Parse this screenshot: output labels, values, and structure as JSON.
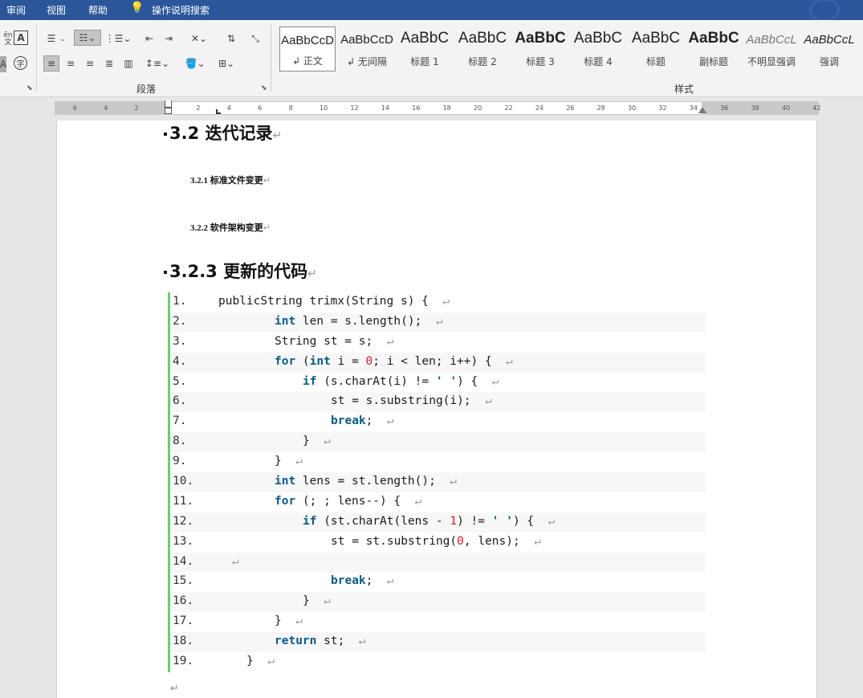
{
  "menubar": {
    "items": [
      "审阅",
      "视图",
      "帮助",
      "操作说明搜索"
    ]
  },
  "ribbon": {
    "groups": {
      "paragraph": "段落",
      "styles": "样式"
    },
    "styles": [
      {
        "preview": "AaBbCcD",
        "name": "↲ 正文",
        "selected": true
      },
      {
        "preview": "AaBbCcD",
        "name": "↲ 无间隔"
      },
      {
        "preview": "AaBbC",
        "name": "标题 1"
      },
      {
        "preview": "AaBbC",
        "name": "标题 2"
      },
      {
        "preview": "AaBbC",
        "name": "标题 3"
      },
      {
        "preview": "AaBbC",
        "name": "标题 4"
      },
      {
        "preview": "AaBbC",
        "name": "标题"
      },
      {
        "preview": "AaBbC",
        "name": "副标题"
      },
      {
        "preview": "AaBbCcL",
        "name": "不明显强调"
      },
      {
        "preview": "AaBbCcL",
        "name": "强调"
      }
    ],
    "left_labels": {
      "wen": "ēn",
      "wen2": "文",
      "A": "A",
      "zi": "字"
    }
  },
  "ruler": {
    "numbers": [
      "6",
      "4",
      "2",
      "2",
      "4",
      "6",
      "8",
      "10",
      "12",
      "14",
      "16",
      "18",
      "20",
      "22",
      "24",
      "26",
      "28",
      "30",
      "32",
      "34",
      "36",
      "38",
      "40",
      "42"
    ]
  },
  "document": {
    "h2": "3.2  迭代记录",
    "h3_1": "3.2.1  标准文件变更",
    "h3_2": "3.2.2  软件架构变更",
    "h3_3": "3.2.3  更新的代码",
    "return_mark": "↵",
    "code_lines": [
      {
        "n": "1."
      },
      {
        "n": "2."
      },
      {
        "n": "3."
      },
      {
        "n": "4."
      },
      {
        "n": "5."
      },
      {
        "n": "6."
      },
      {
        "n": "7."
      },
      {
        "n": "8."
      },
      {
        "n": "9."
      },
      {
        "n": "10."
      },
      {
        "n": "11."
      },
      {
        "n": "12."
      },
      {
        "n": "13."
      },
      {
        "n": "14."
      },
      {
        "n": "15."
      },
      {
        "n": "16."
      },
      {
        "n": "17."
      },
      {
        "n": "18."
      },
      {
        "n": "19."
      }
    ],
    "code": {
      "l1": "publicString trimx(String s) {",
      "l2a": "int",
      "l2b": " len = s.length();",
      "l3": "String st = s;",
      "l4a": "for",
      "l4b": " (",
      "l4c": "int",
      "l4d": " i = ",
      "l4e": "0",
      "l4f": "; i < len; i++) {",
      "l5a": "if",
      "l5b": " (s.charAt(i) != ",
      "l5c": "' '",
      "l5d": ") {",
      "l6": "st = s.substring(i);",
      "l7": "break",
      "l7b": ";",
      "l8": "}",
      "l9": "}",
      "l10a": "int",
      "l10b": " lens = st.length();",
      "l11a": "for",
      "l11b": " (; ; lens--) {",
      "l12a": "if",
      "l12b": " (st.charAt(lens - ",
      "l12c": "1",
      "l12d": ") != ",
      "l12e": "' '",
      "l12f": ") {",
      "l13a": "st = st.substring(",
      "l13b": "0",
      "l13c": ", lens);",
      "l15": "break",
      "l15b": ";",
      "l16": "}",
      "l17": "}",
      "l18a": "return",
      "l18b": " st;",
      "l19": "}"
    }
  }
}
